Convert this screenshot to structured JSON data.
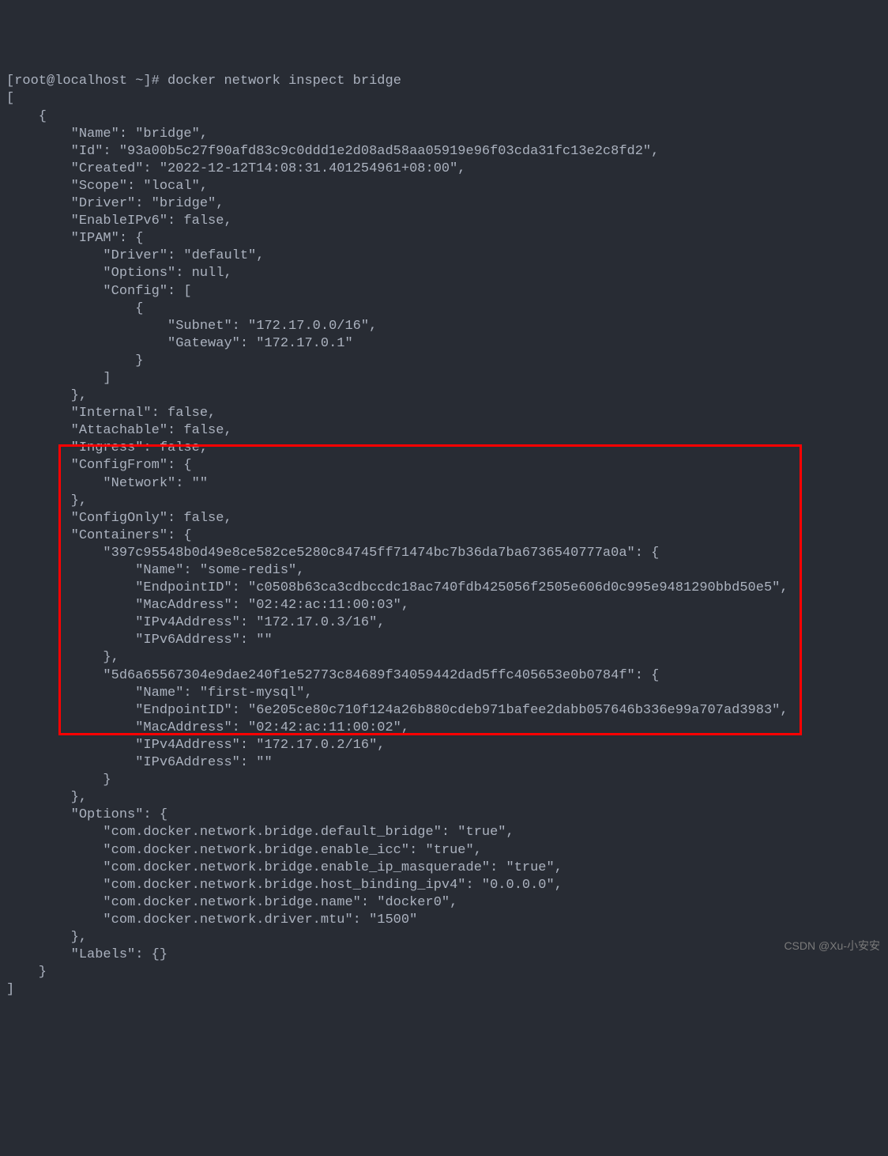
{
  "prompt": "[root@localhost ~]# ",
  "command": "docker network inspect bridge",
  "json_open": "[",
  "line_obj_open": "    {",
  "line_name": "        \"Name\": \"bridge\",",
  "line_id": "        \"Id\": \"93a00b5c27f90afd83c9c0ddd1e2d08ad58aa05919e96f03cda31fc13e2c8fd2\",",
  "line_created": "        \"Created\": \"2022-12-12T14:08:31.401254961+08:00\",",
  "line_scope": "        \"Scope\": \"local\",",
  "line_driver": "        \"Driver\": \"bridge\",",
  "line_ipv6": "        \"EnableIPv6\": false,",
  "line_ipam": "        \"IPAM\": {",
  "line_ipam_driver": "            \"Driver\": \"default\",",
  "line_ipam_options": "            \"Options\": null,",
  "line_ipam_config": "            \"Config\": [",
  "line_ipam_config_open": "                {",
  "line_subnet": "                    \"Subnet\": \"172.17.0.0/16\",",
  "line_gateway": "                    \"Gateway\": \"172.17.0.1\"",
  "line_ipam_config_close": "                }",
  "line_ipam_config_arr_close": "            ]",
  "line_ipam_close": "        },",
  "line_internal": "        \"Internal\": false,",
  "line_attachable": "        \"Attachable\": false,",
  "line_ingress": "        \"Ingress\": false,",
  "line_configfrom": "        \"ConfigFrom\": {",
  "line_configfrom_net": "            \"Network\": \"\"",
  "line_configfrom_close": "        },",
  "line_configonly": "        \"ConfigOnly\": false,",
  "line_containers": "        \"Containers\": {",
  "line_c1_id": "            \"397c95548b0d49e8ce582ce5280c84745ff71474bc7b36da7ba6736540777a0a\": {",
  "line_c1_name": "                \"Name\": \"some-redis\",",
  "line_c1_endpoint": "                \"EndpointID\": \"c0508b63ca3cdbccdc18ac740fdb425056f2505e606d0c995e9481290bbd50e5\",",
  "line_c1_mac": "                \"MacAddress\": \"02:42:ac:11:00:03\",",
  "line_c1_ipv4": "                \"IPv4Address\": \"172.17.0.3/16\",",
  "line_c1_ipv6": "                \"IPv6Address\": \"\"",
  "line_c1_close": "            },",
  "line_c2_id": "            \"5d6a65567304e9dae240f1e52773c84689f34059442dad5ffc405653e0b0784f\": {",
  "line_c2_name": "                \"Name\": \"first-mysql\",",
  "line_c2_endpoint": "                \"EndpointID\": \"6e205ce80c710f124a26b880cdeb971bafee2dabb057646b336e99a707ad3983\",",
  "line_c2_mac": "                \"MacAddress\": \"02:42:ac:11:00:02\",",
  "line_c2_ipv4": "                \"IPv4Address\": \"172.17.0.2/16\",",
  "line_c2_ipv6": "                \"IPv6Address\": \"\"",
  "line_c2_close": "            }",
  "line_containers_close": "        },",
  "line_options": "        \"Options\": {",
  "line_opt_default": "            \"com.docker.network.bridge.default_bridge\": \"true\",",
  "line_opt_icc": "            \"com.docker.network.bridge.enable_icc\": \"true\",",
  "line_opt_masq": "            \"com.docker.network.bridge.enable_ip_masquerade\": \"true\",",
  "line_opt_bind": "            \"com.docker.network.bridge.host_binding_ipv4\": \"0.0.0.0\",",
  "line_opt_name": "            \"com.docker.network.bridge.name\": \"docker0\",",
  "line_opt_mtu": "            \"com.docker.network.driver.mtu\": \"1500\"",
  "line_options_close": "        },",
  "line_labels": "        \"Labels\": {}",
  "line_obj_close": "    }",
  "json_close": "]",
  "watermark": "CSDN @Xu-小安安"
}
